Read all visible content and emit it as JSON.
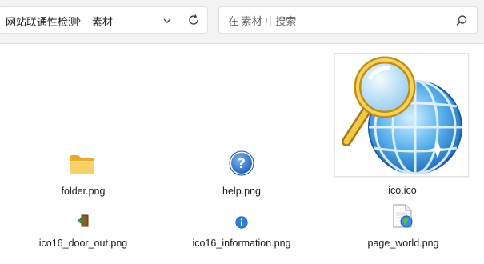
{
  "address_bar": {
    "breadcrumbs": [
      "网站联通性检测",
      "素材"
    ],
    "separator": "›"
  },
  "search": {
    "placeholder": "在 素材 中搜索"
  },
  "files": [
    {
      "name": "folder.png",
      "icon": "folder-icon"
    },
    {
      "name": "help.png",
      "icon": "help-icon"
    },
    {
      "name": "ico.ico",
      "icon": "globe-magnifier-icon"
    },
    {
      "name": "ico16_door_out.png",
      "icon": "door-out-icon"
    },
    {
      "name": "ico16_information.png",
      "icon": "information-icon"
    },
    {
      "name": "page_world.png",
      "icon": "page-world-icon"
    }
  ]
}
